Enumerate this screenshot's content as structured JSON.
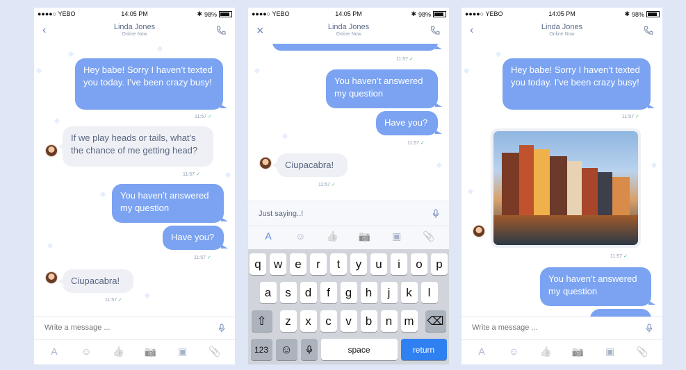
{
  "statusbar": {
    "carrier": "●●●●○ YEBO",
    "time": "14:05 PM",
    "battery": "98%"
  },
  "contact": {
    "name": "Linda Jones",
    "status": "Online Now"
  },
  "messages": {
    "hey": "Hey babe! Sorry I haven’t texted you today. I’ve been crazy busy!",
    "heads": "If we play heads or tails, what’s the chance of me getting head?",
    "answer": "You haven’t answered my question",
    "have_you": "Have you?",
    "ciupa": "Ciupacabra!",
    "time": "11:57",
    "check": "✓"
  },
  "composer": {
    "placeholder": "Write a message ...",
    "typed": "Just saying..!"
  },
  "keyboard": {
    "row1": [
      "q",
      "w",
      "e",
      "r",
      "t",
      "y",
      "u",
      "i",
      "o",
      "p"
    ],
    "row2": [
      "a",
      "s",
      "d",
      "f",
      "g",
      "h",
      "j",
      "k",
      "l"
    ],
    "row3": [
      "z",
      "x",
      "c",
      "v",
      "b",
      "n",
      "m"
    ],
    "shift": "⇧",
    "backspace": "⌫",
    "numbers": "123",
    "emoji": "☺",
    "mic": "🎤",
    "space": "space",
    "return": "return"
  },
  "icons": {
    "back": "‹",
    "close": "×",
    "text": "A",
    "smile": "☺",
    "like": "👍",
    "camera": "📷",
    "gallery": "▣",
    "attach": "📎"
  },
  "colors": {
    "accent": "#7ba3f2",
    "incoming": "#eef0f5",
    "check": "#49c26e",
    "background": "#dfe6f5"
  }
}
